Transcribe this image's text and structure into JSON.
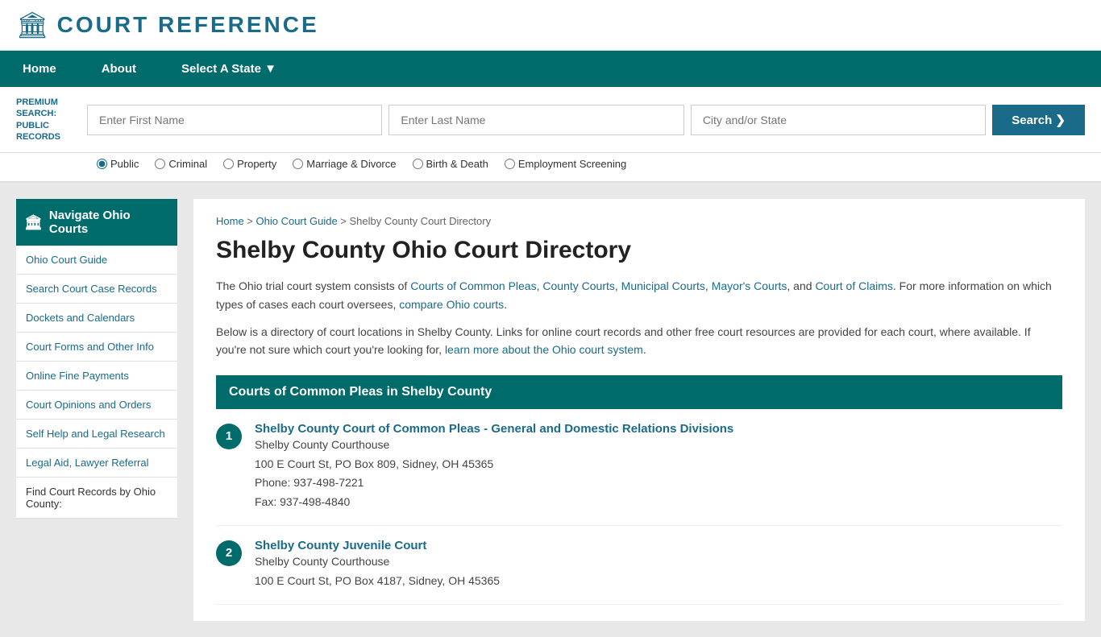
{
  "header": {
    "logo_icon": "🏛",
    "logo_text": "COURT REFERENCE"
  },
  "navbar": {
    "items": [
      {
        "label": "Home",
        "active": false
      },
      {
        "label": "About",
        "active": false
      },
      {
        "label": "Select A State ▼",
        "active": false
      }
    ]
  },
  "search_bar": {
    "premium_label": "PREMIUM SEARCH: PUBLIC RECORDS",
    "first_name_placeholder": "Enter First Name",
    "last_name_placeholder": "Enter Last Name",
    "city_state_placeholder": "City and/or State",
    "button_label": "Search ❯"
  },
  "radio_options": [
    {
      "label": "Public",
      "checked": true
    },
    {
      "label": "Criminal",
      "checked": false
    },
    {
      "label": "Property",
      "checked": false
    },
    {
      "label": "Marriage & Divorce",
      "checked": false
    },
    {
      "label": "Birth & Death",
      "checked": false
    },
    {
      "label": "Employment Screening",
      "checked": false
    }
  ],
  "sidebar": {
    "header": "Navigate Ohio Courts",
    "links": [
      "Ohio Court Guide",
      "Search Court Case Records",
      "Dockets and Calendars",
      "Court Forms and Other Info",
      "Online Fine Payments",
      "Court Opinions and Orders",
      "Self Help and Legal Research",
      "Legal Aid, Lawyer Referral"
    ],
    "static_text": "Find Court Records by Ohio County:"
  },
  "breadcrumb": {
    "home": "Home",
    "guide": "Ohio Court Guide",
    "current": "Shelby County Court Directory"
  },
  "page_title": "Shelby County Ohio Court Directory",
  "intro": {
    "para1": "The Ohio trial court system consists of Courts of Common Pleas, County Courts, Municipal Courts, Mayor's Courts, and Court of Claims. For more information on which types of cases each court oversees, compare Ohio courts.",
    "para2": "Below is a directory of court locations in Shelby County. Links for online court records and other free court resources are provided for each court, where available. If you're not sure which court you're looking for, learn more about the Ohio court system."
  },
  "section1_header": "Courts of Common Pleas in Shelby County",
  "courts": [
    {
      "num": 1,
      "name": "Shelby County Court of Common Pleas - General and Domestic Relations Divisions",
      "building": "Shelby County Courthouse",
      "address": "100 E Court St, PO Box 809, Sidney, OH 45365",
      "phone": "Phone: 937-498-7221",
      "fax": "Fax: 937-498-4840"
    },
    {
      "num": 2,
      "name": "Shelby County Juvenile Court",
      "building": "Shelby County Courthouse",
      "address": "100 E Court St, PO Box 4187, Sidney, OH 45365",
      "phone": "",
      "fax": ""
    }
  ]
}
